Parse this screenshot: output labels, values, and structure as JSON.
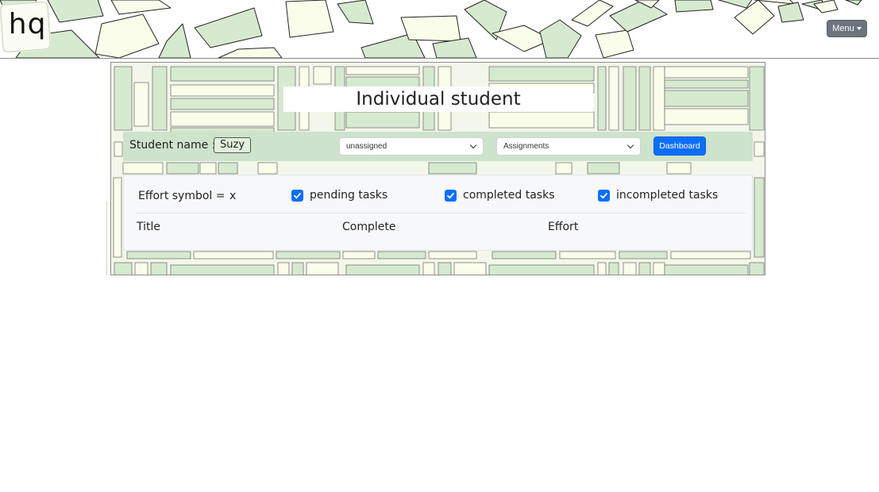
{
  "app": {
    "logo_text": "hq",
    "menu_label": "Menu"
  },
  "page": {
    "title": "Individual student"
  },
  "student_bar": {
    "label": "Student name :",
    "name": "Suzy",
    "assignee_select": {
      "selected": "unassigned"
    },
    "view_select": {
      "selected": "Assignments"
    },
    "dashboard_label": "Dashboard"
  },
  "tasks": {
    "effort_label": "Effort symbol =",
    "effort_value": "x",
    "filters": [
      {
        "label": "pending tasks",
        "checked": true
      },
      {
        "label": "completed tasks",
        "checked": true
      },
      {
        "label": "incompleted tasks",
        "checked": true
      }
    ],
    "columns": [
      "Title",
      "Complete",
      "Effort"
    ]
  },
  "colors": {
    "accent": "#0d6efd",
    "menu_button": "#6c757d",
    "student_bar": "#cde3cb",
    "paper_green": "#d6ead0",
    "paper_cream": "#fbfdeb"
  }
}
